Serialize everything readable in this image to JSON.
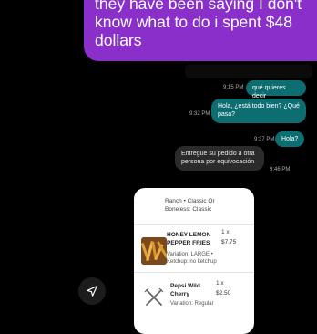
{
  "caption": {
    "text": "they have been saying I don't know what to do i spent $48 dollars",
    "color": "#8a2fc9"
  },
  "messages": [
    {
      "time": "9:15 PM",
      "text": "qué quieres decir",
      "direction": "outgoing"
    },
    {
      "time": "9:32 PM",
      "text": "Hola, ¿está todo bien? ¿Qué pasa?",
      "direction": "outgoing"
    },
    {
      "time": "9:37 PM",
      "text": "Hola?",
      "direction": "outgoing"
    },
    {
      "time": "9:46 PM",
      "text": "Entregue su pedido a otra persona por equivocación",
      "direction": "incoming"
    }
  ],
  "order_card": {
    "top_text": "Ranch • Classic Or Boneless: Classic",
    "items": [
      {
        "name": "HONEY LEMON PEPPER FRIES",
        "qty": "1 x",
        "price": "$7.75",
        "variation": "Variation: LARGE • Ketchup: no ketchup",
        "icon": "fries-photo"
      },
      {
        "name": "Pepsi Wild Cherry",
        "qty": "1 x",
        "price": "$2.50",
        "variation": "Variation: Regular",
        "icon": "utensils-icon"
      }
    ]
  },
  "share_button": {
    "icon": "send-icon"
  },
  "colors": {
    "outgoing_bubble": "#0d6e72",
    "incoming_bubble": "#2b2b2b"
  }
}
